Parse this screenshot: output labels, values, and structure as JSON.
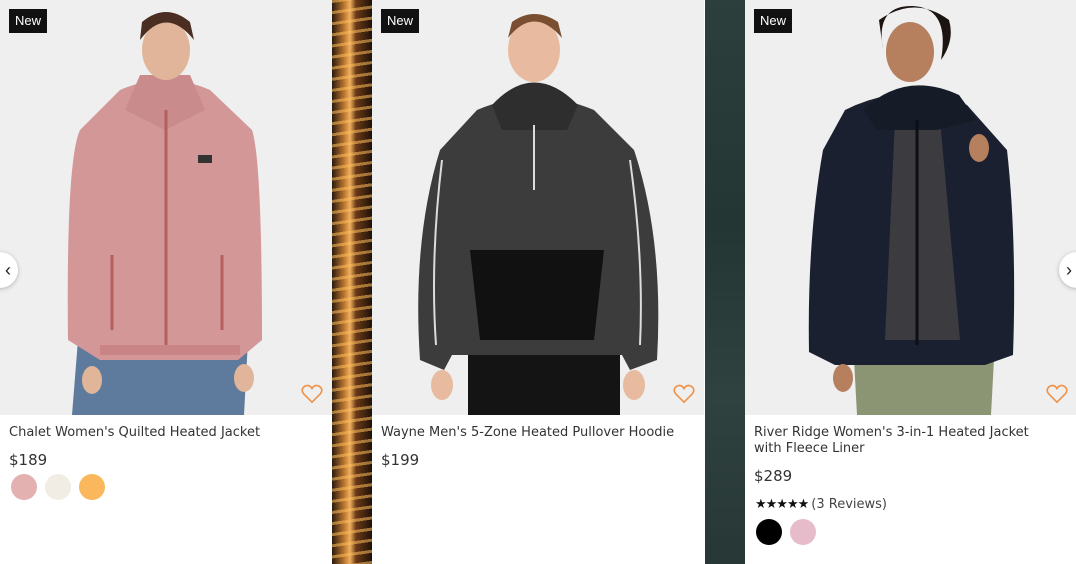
{
  "products": [
    {
      "badge": "New",
      "name": "Chalet Women's Quilted Heated Jacket",
      "price": "$189",
      "swatches": [
        "#e4b1b1",
        "#f1ede4",
        "#fbb75c"
      ]
    },
    {
      "badge": "New",
      "name": "Wayne Men's 5-Zone Heated Pullover Hoodie",
      "price": "$199",
      "swatches": []
    },
    {
      "badge": "New",
      "name": "River Ridge Women's 3-in-1 Heated Jacket with Fleece Liner",
      "price": "$289",
      "stars": "★★★★★",
      "reviews": "(3 Reviews)",
      "swatches": [
        "#000000",
        "#e6bccb"
      ]
    }
  ],
  "nav": {
    "prev": "‹",
    "next": "›"
  },
  "colors": {
    "accent_heart": "#f0934a",
    "badge_bg": "#111111"
  }
}
